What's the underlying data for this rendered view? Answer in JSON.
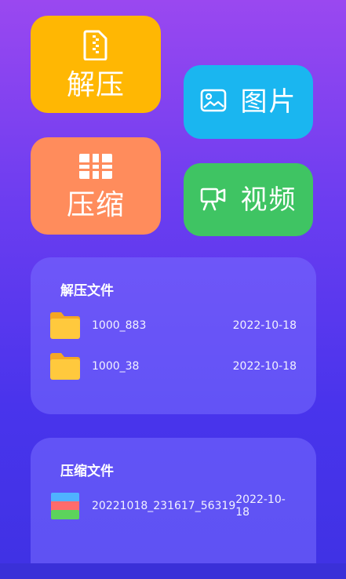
{
  "tiles": {
    "extract_label": "解压",
    "compress_label": "压缩",
    "images_label": "图片",
    "video_label": "视频"
  },
  "extracted_files": {
    "title": "解压文件",
    "items": [
      {
        "name": "1000_883",
        "date": "2022-10-18",
        "icon": "folder-icon"
      },
      {
        "name": "1000_38",
        "date": "2022-10-18",
        "icon": "folder-icon"
      }
    ]
  },
  "compressed_files": {
    "title": "压缩文件",
    "items": [
      {
        "name": "20221018_231617_56319",
        "date": "2022-10-18",
        "icon": "archive-icon"
      }
    ]
  },
  "colors": {
    "extract_tile": "#ffb703",
    "compress_tile": "#ff8c5c",
    "images_tile": "#1ab6f0",
    "video_tile": "#3fc463"
  }
}
